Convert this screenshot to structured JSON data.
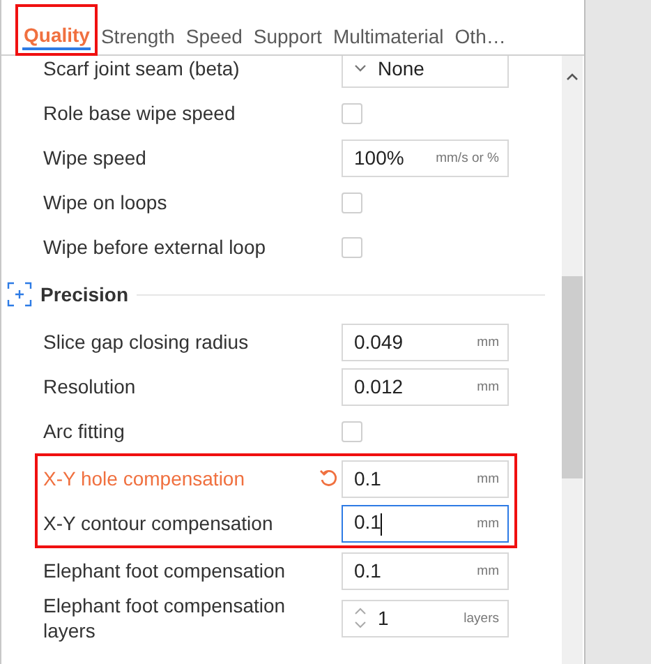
{
  "tabs": [
    {
      "label": "Quality",
      "selected": true,
      "highlighted": true
    },
    {
      "label": "Strength",
      "selected": false,
      "highlighted": false
    },
    {
      "label": "Speed",
      "selected": false,
      "highlighted": false
    },
    {
      "label": "Support",
      "selected": false,
      "highlighted": false
    },
    {
      "label": "Multimaterial",
      "selected": false,
      "highlighted": false
    },
    {
      "label": "Oth…",
      "selected": false,
      "highlighted": false
    }
  ],
  "rows": [
    {
      "kind": "dropdown",
      "label": "Scarf joint seam (beta)",
      "value": "None"
    },
    {
      "kind": "checkbox",
      "label": "Role base wipe speed",
      "checked": false
    },
    {
      "kind": "field",
      "label": "Wipe speed",
      "value": "100%",
      "unit": "mm/s or %"
    },
    {
      "kind": "checkbox",
      "label": "Wipe on loops",
      "checked": false
    },
    {
      "kind": "checkbox",
      "label": "Wipe before external loop",
      "checked": false
    },
    {
      "kind": "section",
      "label": "Precision"
    },
    {
      "kind": "field",
      "label": "Slice gap closing radius",
      "value": "0.049",
      "unit": "mm"
    },
    {
      "kind": "field",
      "label": "Resolution",
      "value": "0.012",
      "unit": "mm"
    },
    {
      "kind": "checkbox",
      "label": "Arc fitting",
      "checked": false
    },
    {
      "kind": "field",
      "label": "X-Y hole compensation",
      "value": "0.1",
      "unit": "mm",
      "modified": true,
      "focused": false,
      "highlighted": true
    },
    {
      "kind": "field",
      "label": "X-Y contour compensation",
      "value": "0.1",
      "unit": "mm",
      "modified": false,
      "focused": true,
      "highlighted": true
    },
    {
      "kind": "field",
      "label": "Elephant foot compensation",
      "value": "0.1",
      "unit": "mm"
    },
    {
      "kind": "spin",
      "label": "Elephant foot compensation layers",
      "value": "1",
      "unit": "layers"
    }
  ]
}
